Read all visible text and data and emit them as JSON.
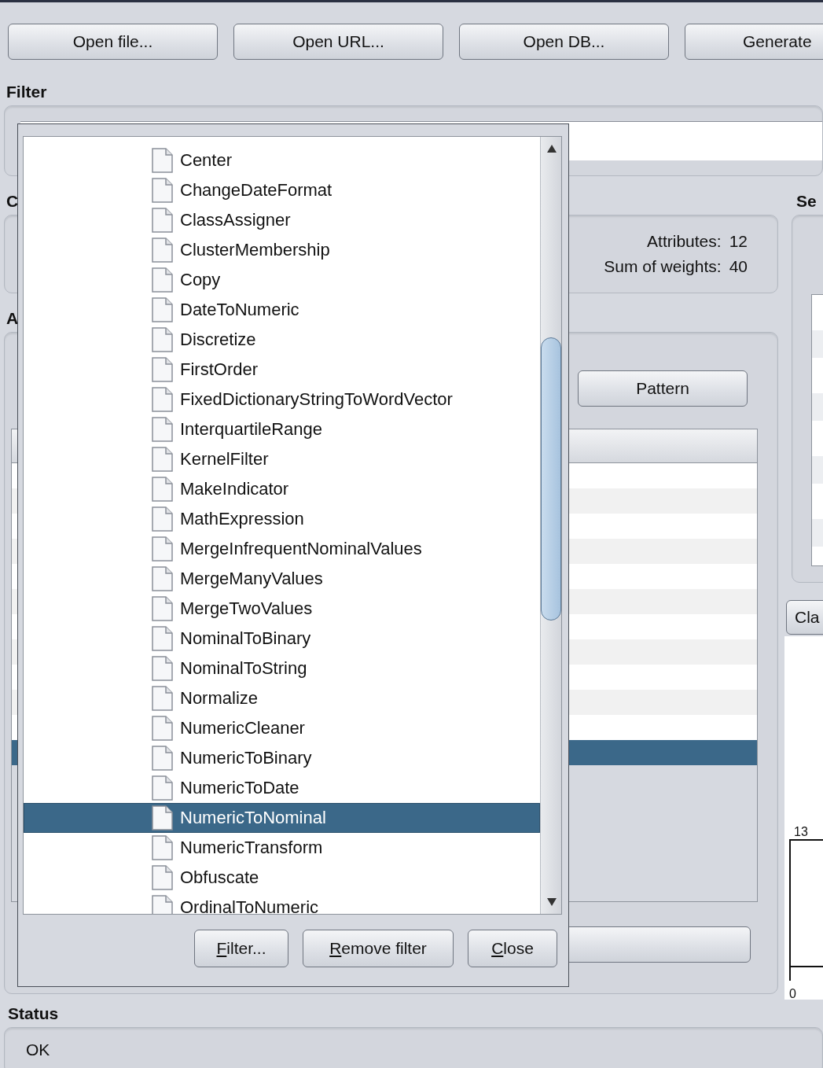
{
  "toolbar": [
    {
      "label": "Open file..."
    },
    {
      "label": "Open URL..."
    },
    {
      "label": "Open DB..."
    },
    {
      "label": "Generate",
      "cut": true
    }
  ],
  "filter": {
    "label": "Filter"
  },
  "current_relation": {
    "label": "C",
    "attributes_label": "Attributes:",
    "attributes": "12",
    "weights_label": "Sum of weights:",
    "weights": "40"
  },
  "attributes": {
    "label": "A",
    "pattern_button": "Pattern",
    "rows": [
      {
        "selected": false
      },
      {
        "selected": false
      },
      {
        "selected": false
      },
      {
        "selected": false
      },
      {
        "selected": false
      },
      {
        "selected": false
      },
      {
        "selected": false
      },
      {
        "selected": false
      },
      {
        "selected": false
      },
      {
        "selected": false
      },
      {
        "selected": false
      },
      {
        "selected": true
      }
    ]
  },
  "selected_attribute": {
    "label": "Se",
    "class_button": "Cla",
    "histogram_max": "13",
    "histogram_min": "0"
  },
  "status": {
    "label": "Status",
    "message": "OK"
  },
  "filter_popup": {
    "items": [
      {
        "label": "Center",
        "selected": false
      },
      {
        "label": "ChangeDateFormat",
        "selected": false
      },
      {
        "label": "ClassAssigner",
        "selected": false
      },
      {
        "label": "ClusterMembership",
        "selected": false
      },
      {
        "label": "Copy",
        "selected": false
      },
      {
        "label": "DateToNumeric",
        "selected": false
      },
      {
        "label": "Discretize",
        "selected": false
      },
      {
        "label": "FirstOrder",
        "selected": false
      },
      {
        "label": "FixedDictionaryStringToWordVector",
        "selected": false
      },
      {
        "label": "InterquartileRange",
        "selected": false
      },
      {
        "label": "KernelFilter",
        "selected": false
      },
      {
        "label": "MakeIndicator",
        "selected": false
      },
      {
        "label": "MathExpression",
        "selected": false
      },
      {
        "label": "MergeInfrequentNominalValues",
        "selected": false
      },
      {
        "label": "MergeManyValues",
        "selected": false
      },
      {
        "label": "MergeTwoValues",
        "selected": false
      },
      {
        "label": "NominalToBinary",
        "selected": false
      },
      {
        "label": "NominalToString",
        "selected": false
      },
      {
        "label": "Normalize",
        "selected": false
      },
      {
        "label": "NumericCleaner",
        "selected": false
      },
      {
        "label": "NumericToBinary",
        "selected": false
      },
      {
        "label": "NumericToDate",
        "selected": false
      },
      {
        "label": "NumericToNominal",
        "selected": true
      },
      {
        "label": "NumericTransform",
        "selected": false
      },
      {
        "label": "Obfuscate",
        "selected": false
      },
      {
        "label": "OrdinalToNumeric",
        "selected": false
      }
    ],
    "buttons": [
      {
        "label": "Filter..."
      },
      {
        "label": "Remove filter"
      },
      {
        "label": "Close"
      }
    ]
  }
}
